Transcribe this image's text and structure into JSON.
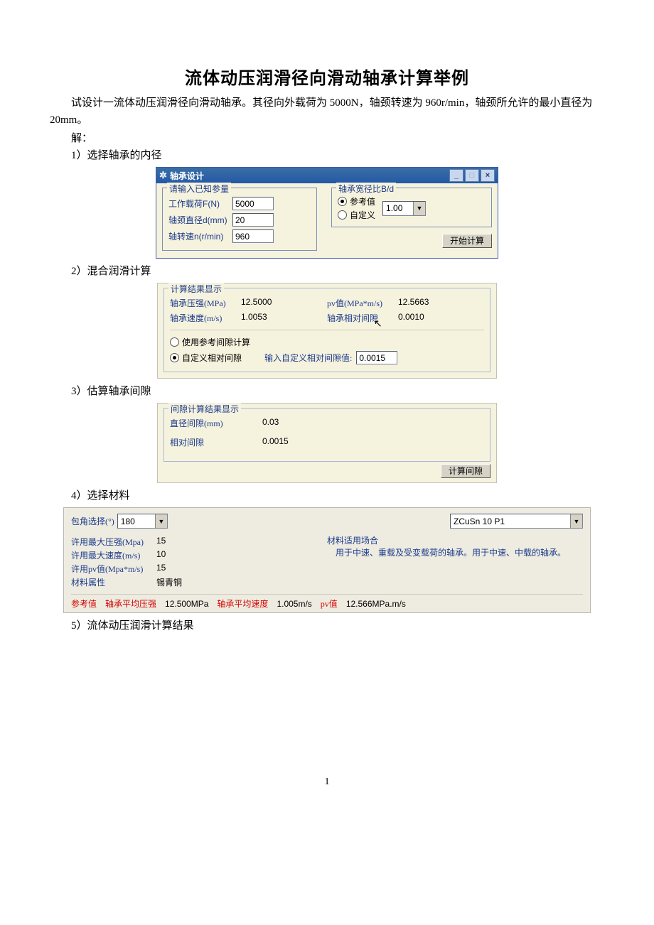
{
  "title": "流体动压润滑径向滑动轴承计算举例",
  "intro": "试设计一流体动压润滑径向滑动轴承。其径向外载荷为 5000N，轴颈转速为 960r/min，轴颈所允许的最小直径为 20mm。",
  "solve_label": "解：",
  "steps": {
    "s1": "1）选择轴承的内径",
    "s2": "2）混合润滑计算",
    "s3": "3）估算轴承间隙",
    "s4": "4）选择材料",
    "s5": "5）流体动压润滑计算结果"
  },
  "shot1": {
    "window_title": "轴承设计",
    "group_input": "请输入已知参量",
    "f_label": "工作载荷F(N)",
    "f_val": "5000",
    "d_label": "轴颈直径d(mm)",
    "d_val": "20",
    "n_label": "轴转速n(r/min)",
    "n_val": "960",
    "group_bd": "轴承宽径比B/d",
    "opt_ref": "参考值",
    "opt_custom": "自定义",
    "bd_val": "1.00",
    "btn_start": "开始计算"
  },
  "shot2": {
    "group": "计算结果显示",
    "r1k": "轴承压强(MPa)",
    "r1v": "12.5000",
    "r2k": "轴承速度(m/s)",
    "r2v": "1.0053",
    "r3k": "pv值(MPa*m/s)",
    "r3v": "12.5663",
    "r4k": "轴承相对间隙",
    "r4v": "0.0010",
    "opt1": "使用参考间隙计算",
    "opt2": "自定义相对间隙",
    "custom_lbl": "输入自定义相对间隙值:",
    "custom_val": "0.0015"
  },
  "shot3": {
    "group": "间隙计算结果显示",
    "k1": "直径间隙(mm)",
    "v1": "0.03",
    "k2": "相对间隙",
    "v2": "0.0015",
    "btn": "计算间隙"
  },
  "shot4": {
    "angle_lbl": "包角选择(°)",
    "angle_val": "180",
    "mat_val": "ZCuSn 10 P1",
    "k1": "许用最大压强(Mpa)",
    "v1": "15",
    "k2": "许用最大速度(m/s)",
    "v2": "10",
    "k3": "许用pv值(Mpa*m/s)",
    "v3": "15",
    "k4": "材料属性",
    "v4": "锡青铜",
    "usecase_lbl": "材料适用场合",
    "usecase_txt": "用于中速、重载及受变载荷的轴承。用于中速、中载的轴承。",
    "ref_lbl": "参考值",
    "bp_lbl": "轴承平均压强",
    "bp_val": "12.500MPa",
    "bv_lbl": "轴承平均速度",
    "bv_val": "1.005m/s",
    "pv_lbl": "pv值",
    "pv_val": "12.566MPa.m/s"
  },
  "page_number": "1"
}
